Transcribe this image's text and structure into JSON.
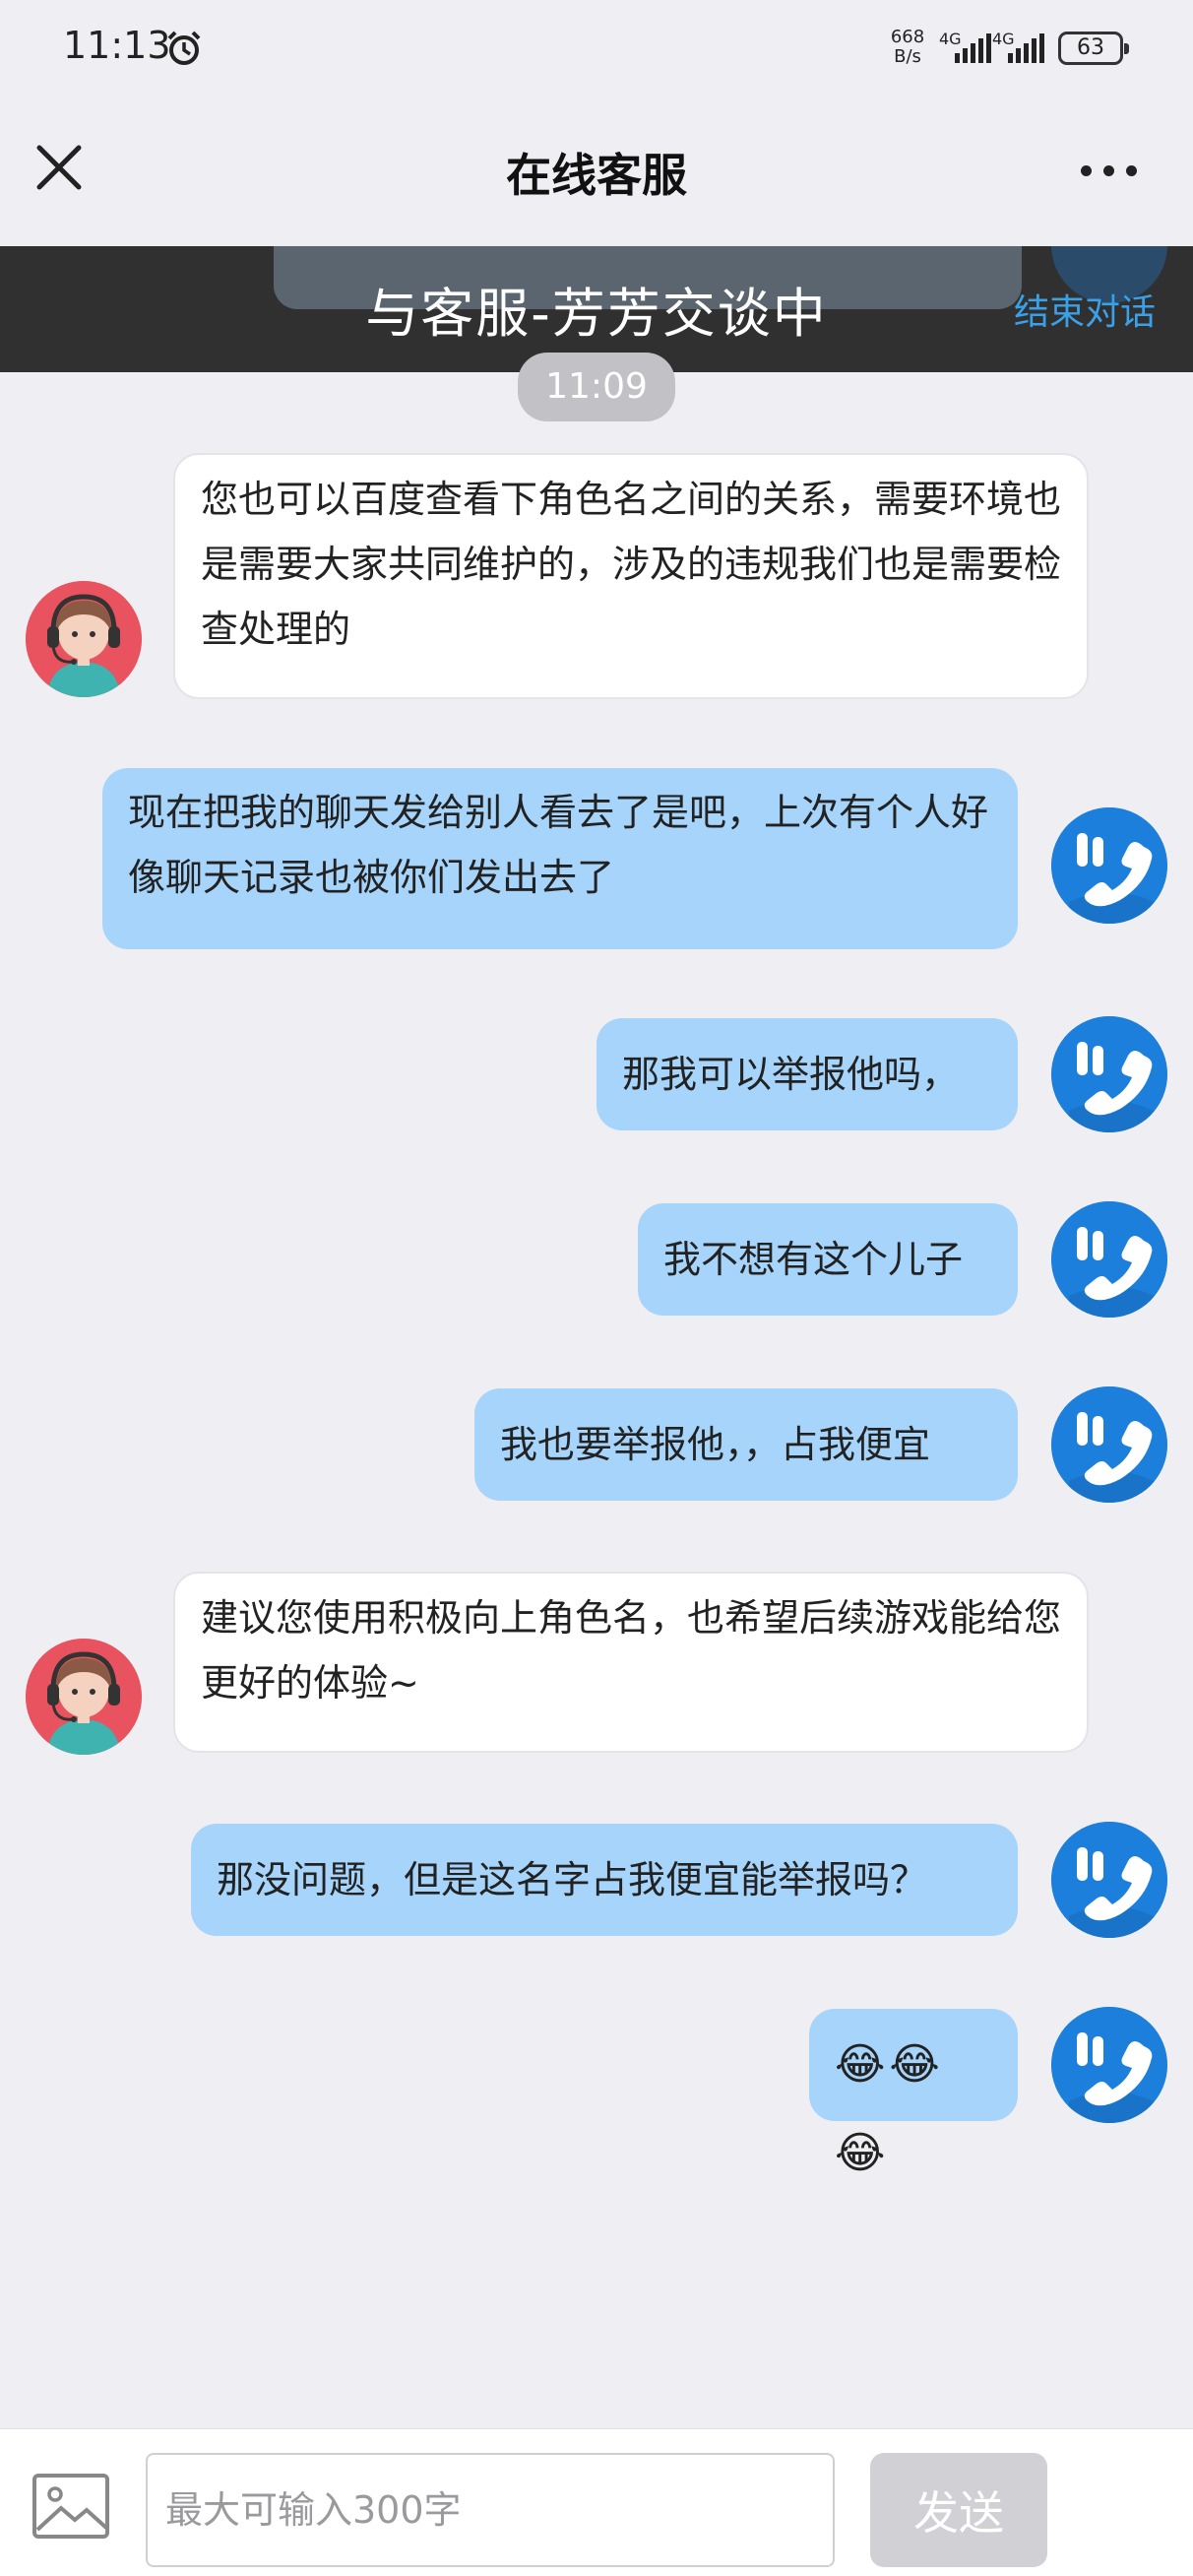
{
  "status_bar": {
    "time": "11:13",
    "net_speed_value": "668",
    "net_speed_unit": "B/s",
    "signal1_label": "4G",
    "signal2_label": "4G",
    "battery": "63"
  },
  "header": {
    "title": "在线客服"
  },
  "banner": {
    "title": "与客服-芳芳交谈中",
    "end_label": "结束对话"
  },
  "time_chip": "11:09",
  "messages": [
    {
      "from": "agent",
      "text": "您也可以百度查看下角色名之间的关系，需要环境也是需要大家共同维护的，涉及的违规我们也是需要检查处理的"
    },
    {
      "from": "user",
      "text": "现在把我的聊天发给别人看去了是吧，上次有个人好像聊天记录也被你们发出去了"
    },
    {
      "from": "user",
      "text": "那我可以举报他吗，"
    },
    {
      "from": "user",
      "text": "我不想有这个儿子"
    },
    {
      "from": "user",
      "text": "我也要举报他，，占我便宜"
    },
    {
      "from": "agent",
      "text": "建议您使用积极向上角色名，也希望后续游戏能给您更好的体验~"
    },
    {
      "from": "user",
      "text": "那没问题，但是这名字占我便宜能举报吗？"
    },
    {
      "from": "user",
      "text": "😂😂😂"
    }
  ],
  "input": {
    "placeholder": "最大可输入300字",
    "value": "",
    "send_label": "发送"
  },
  "colors": {
    "background": "#efeff3",
    "user_bubble": "#a6d4fa",
    "agent_bubble": "#ffffff",
    "accent": "#3aa0e8",
    "agent_avatar": "#e9525f",
    "user_avatar": "#1c7fdb"
  },
  "icons": {
    "close": "close-icon",
    "more": "more-dots-icon",
    "alarm": "alarm-icon",
    "image": "image-icon",
    "agent_avatar": "headset-agent-icon",
    "user_avatar": "phone-hand-icon"
  }
}
